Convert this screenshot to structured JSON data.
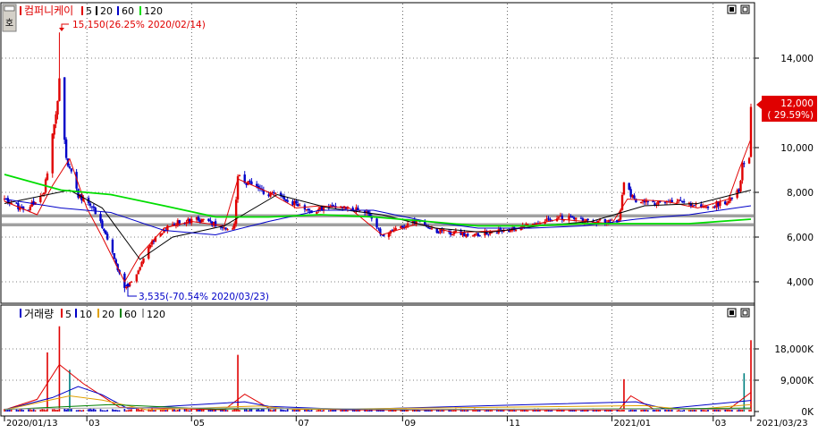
{
  "window": {
    "pin_icon_glyph": "호"
  },
  "price_panel": {
    "name": "컴퍼니케이",
    "ma_labels": [
      "5",
      "20",
      "60",
      "120"
    ]
  },
  "volume_panel": {
    "name": "거래량",
    "ma_labels": [
      "5",
      "10",
      "20",
      "60",
      "120"
    ]
  },
  "annotations": {
    "high_label": "15,150(26.25% 2020/02/14)",
    "low_label": "3,535(-70.54% 2020/03/23)",
    "current_price": "12,000",
    "current_change": "( 29.59%)"
  },
  "colors": {
    "up": "#e00000",
    "down": "#0000c8",
    "ma5": "#e00000",
    "ma20": "#000000",
    "ma60": "#0000c8",
    "ma120": "#00dd00",
    "vol_ma5": "#e00000",
    "vol_ma10": "#0000c8",
    "vol_ma20": "#e0a000",
    "vol_ma60": "#008000",
    "vol_ma120": "#a0a0a0"
  },
  "chart_data": [
    {
      "type": "candlestick",
      "title": "컴퍼니케이",
      "y_ticks": [
        "4,000",
        "6,000",
        "8,000",
        "10,000",
        "14,000"
      ],
      "y_tick_values": [
        4000,
        6000,
        8000,
        10000,
        14000
      ],
      "ylim": [
        3000,
        15700
      ],
      "x_tick_labels": [
        "2020/01/13",
        "03",
        "05",
        "07",
        "09",
        "11",
        "2021/01",
        "03",
        "2021/03/23"
      ],
      "x_range": [
        "2020/01/13",
        "2021/03/23"
      ],
      "key_points": [
        {
          "date": "2020/02/14",
          "value": 15150,
          "label": "high"
        },
        {
          "date": "2020/03/23",
          "value": 3535,
          "label": "low"
        },
        {
          "date": "2021/03/23",
          "value": 12000,
          "label": "last"
        }
      ],
      "series": [
        {
          "name": "5",
          "points": [
            [
              "2020/01/13",
              7600
            ],
            [
              "2020/02/01",
              7000
            ],
            [
              "2020/02/10",
              8300
            ],
            [
              "2020/02/20",
              9500
            ],
            [
              "2020/03/01",
              7300
            ],
            [
              "2020/03/10",
              6000
            ],
            [
              "2020/03/23",
              4000
            ],
            [
              "2020/04/01",
              5200
            ],
            [
              "2020/04/15",
              6400
            ],
            [
              "2020/05/01",
              6700
            ],
            [
              "2020/05/20",
              6500
            ],
            [
              "2020/05/28",
              8600
            ],
            [
              "2020/06/15",
              8000
            ],
            [
              "2020/07/01",
              7300
            ],
            [
              "2020/07/15",
              7400
            ],
            [
              "2020/08/01",
              7300
            ],
            [
              "2020/08/20",
              6100
            ],
            [
              "2020/09/10",
              6600
            ],
            [
              "2020/10/01",
              6200
            ],
            [
              "2020/11/01",
              6300
            ],
            [
              "2020/12/01",
              6800
            ],
            [
              "2021/01/01",
              6600
            ],
            [
              "2021/01/10",
              7700
            ],
            [
              "2021/02/01",
              7600
            ],
            [
              "2021/02/20",
              7300
            ],
            [
              "2021/03/10",
              7700
            ],
            [
              "2021/03/16",
              9000
            ],
            [
              "2021/03/23",
              10400
            ]
          ]
        },
        {
          "name": "20",
          "points": [
            [
              "2020/01/13",
              7500
            ],
            [
              "2020/02/20",
              8100
            ],
            [
              "2020/03/10",
              7300
            ],
            [
              "2020/04/01",
              5000
            ],
            [
              "2020/04/20",
              6000
            ],
            [
              "2020/05/20",
              6500
            ],
            [
              "2020/06/20",
              7900
            ],
            [
              "2020/07/20",
              7300
            ],
            [
              "2020/08/20",
              7000
            ],
            [
              "2020/09/20",
              6400
            ],
            [
              "2020/10/20",
              6200
            ],
            [
              "2020/11/20",
              6500
            ],
            [
              "2020/12/20",
              6700
            ],
            [
              "2021/01/20",
              7400
            ],
            [
              "2021/02/20",
              7500
            ],
            [
              "2021/03/23",
              8100
            ]
          ]
        },
        {
          "name": "60",
          "points": [
            [
              "2020/01/13",
              7700
            ],
            [
              "2020/02/15",
              7300
            ],
            [
              "2020/03/15",
              7100
            ],
            [
              "2020/04/15",
              6300
            ],
            [
              "2020/05/15",
              6100
            ],
            [
              "2020/06/15",
              6700
            ],
            [
              "2020/07/15",
              7200
            ],
            [
              "2020/08/15",
              7200
            ],
            [
              "2020/09/15",
              6700
            ],
            [
              "2020/10/15",
              6400
            ],
            [
              "2020/11/15",
              6400
            ],
            [
              "2020/12/15",
              6500
            ],
            [
              "2021/01/15",
              6800
            ],
            [
              "2021/02/15",
              7000
            ],
            [
              "2021/03/23",
              7400
            ]
          ]
        },
        {
          "name": "120",
          "points": [
            [
              "2020/01/13",
              8800
            ],
            [
              "2020/02/15",
              8100
            ],
            [
              "2020/03/15",
              7900
            ],
            [
              "2020/04/15",
              7400
            ],
            [
              "2020/05/15",
              6900
            ],
            [
              "2020/06/15",
              6900
            ],
            [
              "2020/07/15",
              7000
            ],
            [
              "2020/08/15",
              6900
            ],
            [
              "2020/09/15",
              6700
            ],
            [
              "2020/10/15",
              6500
            ],
            [
              "2020/11/15",
              6500
            ],
            [
              "2020/12/15",
              6600
            ],
            [
              "2021/01/15",
              6600
            ],
            [
              "2021/02/15",
              6600
            ],
            [
              "2021/03/23",
              6800
            ]
          ]
        }
      ]
    },
    {
      "type": "bar",
      "title": "거래량",
      "y_ticks": [
        "0K",
        "9,000K",
        "18,000K"
      ],
      "y_tick_values": [
        0,
        9000,
        18000
      ],
      "ylim": [
        0,
        24000
      ],
      "peaks": [
        {
          "date": "2020/02/07",
          "value": 17000
        },
        {
          "date": "2020/02/14",
          "value": 24500
        },
        {
          "date": "2020/02/20",
          "value": 12000
        },
        {
          "date": "2020/05/28",
          "value": 16300
        },
        {
          "date": "2021/01/08",
          "value": 9300
        },
        {
          "date": "2021/03/19",
          "value": 11000
        },
        {
          "date": "2021/03/23",
          "value": 20500
        }
      ],
      "baseline_value": 600,
      "series": [
        {
          "name": "5",
          "points": [
            [
              "2020/01/13",
              500
            ],
            [
              "2020/02/01",
              3500
            ],
            [
              "2020/02/14",
              13500
            ],
            [
              "2020/02/28",
              8000
            ],
            [
              "2020/03/20",
              1200
            ],
            [
              "2020/05/20",
              500
            ],
            [
              "2020/06/01",
              5000
            ],
            [
              "2020/06/15",
              1000
            ],
            [
              "2020/08/01",
              500
            ],
            [
              "2021/01/05",
              500
            ],
            [
              "2021/01/12",
              4500
            ],
            [
              "2021/01/25",
              800
            ],
            [
              "2021/03/10",
              600
            ],
            [
              "2021/03/23",
              5500
            ]
          ]
        },
        {
          "name": "10",
          "points": [
            [
              "2020/01/13",
              500
            ],
            [
              "2020/02/10",
              4000
            ],
            [
              "2020/02/25",
              7200
            ],
            [
              "2020/03/10",
              4800
            ],
            [
              "2020/03/25",
              800
            ],
            [
              "2020/06/01",
              2800
            ],
            [
              "2020/06/15",
              1500
            ],
            [
              "2020/08/01",
              600
            ],
            [
              "2021/01/15",
              2800
            ],
            [
              "2021/02/01",
              800
            ],
            [
              "2021/03/23",
              3200
            ]
          ]
        },
        {
          "name": "20",
          "points": [
            [
              "2020/01/13",
              500
            ],
            [
              "2020/02/20",
              4500
            ],
            [
              "2020/03/10",
              3300
            ],
            [
              "2020/04/05",
              500
            ],
            [
              "2020/06/10",
              1600
            ],
            [
              "2020/07/01",
              600
            ],
            [
              "2021/01/20",
              1700
            ],
            [
              "2021/02/15",
              500
            ],
            [
              "2021/03/23",
              2000
            ]
          ]
        },
        {
          "name": "60",
          "points": [
            [
              "2020/01/13",
              600
            ],
            [
              "2020/03/15",
              2000
            ],
            [
              "2020/05/15",
              700
            ],
            [
              "2020/07/01",
              900
            ],
            [
              "2020/09/01",
              600
            ],
            [
              "2021/02/01",
              800
            ],
            [
              "2021/03/23",
              1000
            ]
          ]
        },
        {
          "name": "120",
          "points": [
            [
              "2020/01/13",
              700
            ],
            [
              "2020/04/01",
              1100
            ],
            [
              "2020/07/01",
              900
            ],
            [
              "2020/10/01",
              600
            ],
            [
              "2021/03/23",
              700
            ]
          ]
        }
      ]
    }
  ]
}
